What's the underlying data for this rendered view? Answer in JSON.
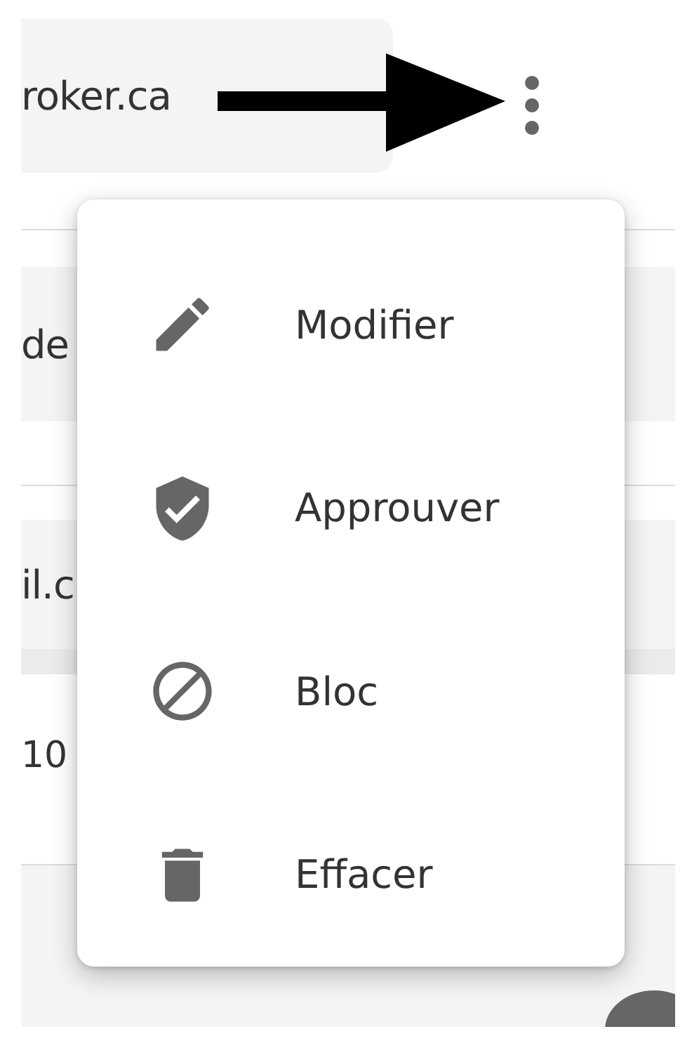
{
  "rows": [
    {
      "kind": "top_field",
      "text": "roker.ca"
    },
    {
      "kind": "field",
      "text": "de"
    },
    {
      "kind": "banded_field",
      "text": "il.c"
    },
    {
      "kind": "cell",
      "text": "10"
    }
  ],
  "menu": {
    "items": [
      {
        "label": "Modifier"
      },
      {
        "label": "Approuver"
      },
      {
        "label": "Bloc"
      },
      {
        "label": "Effacer"
      }
    ]
  }
}
